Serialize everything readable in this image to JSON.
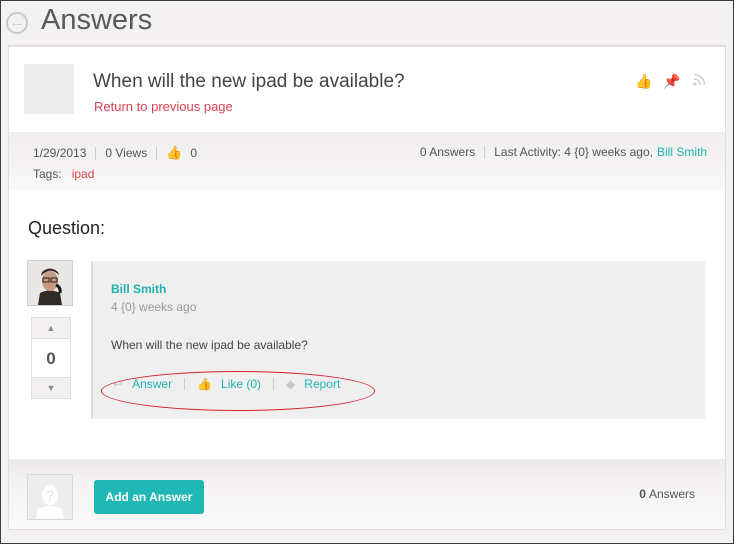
{
  "header": {
    "title": "Answers"
  },
  "question": {
    "title": "When will the new ipad be available?",
    "return_link": "Return to previous page"
  },
  "meta": {
    "date": "1/29/2013",
    "views": "0 Views",
    "likes": "0",
    "answers": "0 Answers",
    "last_activity": "Last Activity: 4 {0} weeks ago,",
    "last_author": "Bill Smith",
    "tags_label": "Tags:",
    "tag": "ipad"
  },
  "section": {
    "question_label": "Question:"
  },
  "vote": {
    "up": "▲",
    "count": "0",
    "down": "▼"
  },
  "post": {
    "author": "Bill Smith",
    "time": "4 {0} weeks ago",
    "body": "When will the new ipad be available?",
    "answer_label": "Answer",
    "like_label": "Like (0)",
    "report_label": "Report"
  },
  "footer": {
    "add_answer": "Add an Answer",
    "answer_count": "0",
    "answer_count_label": "Answers"
  },
  "colors": {
    "accent": "#1fb3b0",
    "link_red": "#d9434f",
    "annotation": "#d51e2b"
  }
}
